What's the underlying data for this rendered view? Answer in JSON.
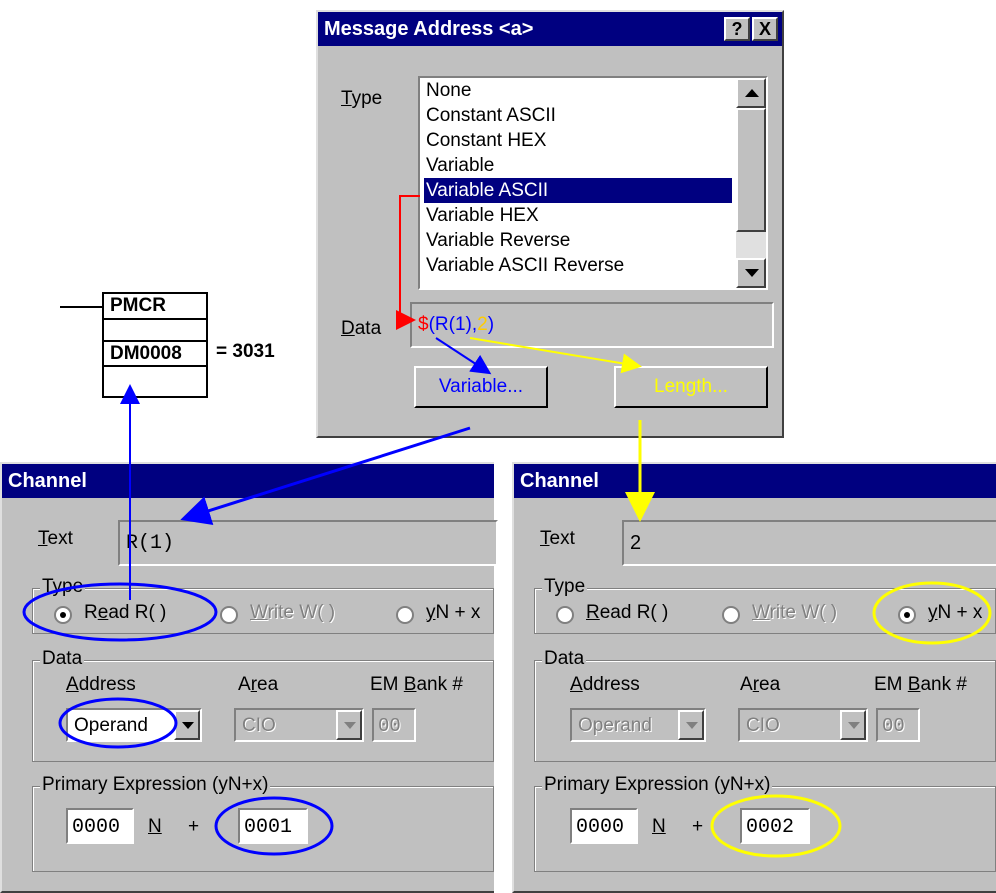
{
  "ladder": {
    "instruction": "PMCR",
    "operand": "DM0008",
    "value": "= 3031"
  },
  "message_dialog": {
    "title": "Message Address <a>",
    "help_label": "?",
    "close_label": "X",
    "type_label": "Type",
    "type_items": [
      "None",
      "Constant ASCII",
      "Constant HEX",
      "Variable",
      "Variable ASCII",
      "Variable HEX",
      "Variable Reverse",
      "Variable ASCII Reverse"
    ],
    "type_selected_index": 4,
    "data_label": "Data",
    "data_expr": {
      "dollar": "$",
      "open": "(",
      "var": "R(1)",
      "comma": ",",
      "len": "2",
      "close": ")"
    },
    "variable_button": "Variable...",
    "length_button": "Length..."
  },
  "channel_left": {
    "title": "Channel",
    "text_label": "Text",
    "text_value": "R(1)",
    "type_group": "Type",
    "radios": [
      "Read R( )",
      "Write W( )",
      "yN + x"
    ],
    "selected_radio": 0,
    "data_group": "Data",
    "address_label": "Address",
    "area_label": "Area",
    "em_bank_label": "EM Bank #",
    "address_value": "Operand",
    "area_value": "CIO",
    "em_bank_value": "00",
    "expr_group": "Primary Expression (yN+x)",
    "n_value": "0000",
    "n_label": "N",
    "plus": "+",
    "x_value": "0001"
  },
  "channel_right": {
    "title": "Channel",
    "text_label": "Text",
    "text_value": "2",
    "type_group": "Type",
    "radios": [
      "Read R( )",
      "Write W( )",
      "yN + x"
    ],
    "selected_radio": 2,
    "data_group": "Data",
    "address_label": "Address",
    "area_label": "Area",
    "em_bank_label": "EM Bank #",
    "address_value": "Operand",
    "area_value": "CIO",
    "em_bank_value": "00",
    "expr_group": "Primary Expression (yN+x)",
    "n_value": "0000",
    "n_label": "N",
    "plus": "+",
    "x_value": "0002"
  },
  "colors": {
    "title_bar": "#000080",
    "dialog_face": "#c0c0c0",
    "selection": "#000080",
    "blue_arrow": "#0000ff",
    "yellow_arrow": "#ffff00",
    "red_arrow": "#ff0000"
  }
}
